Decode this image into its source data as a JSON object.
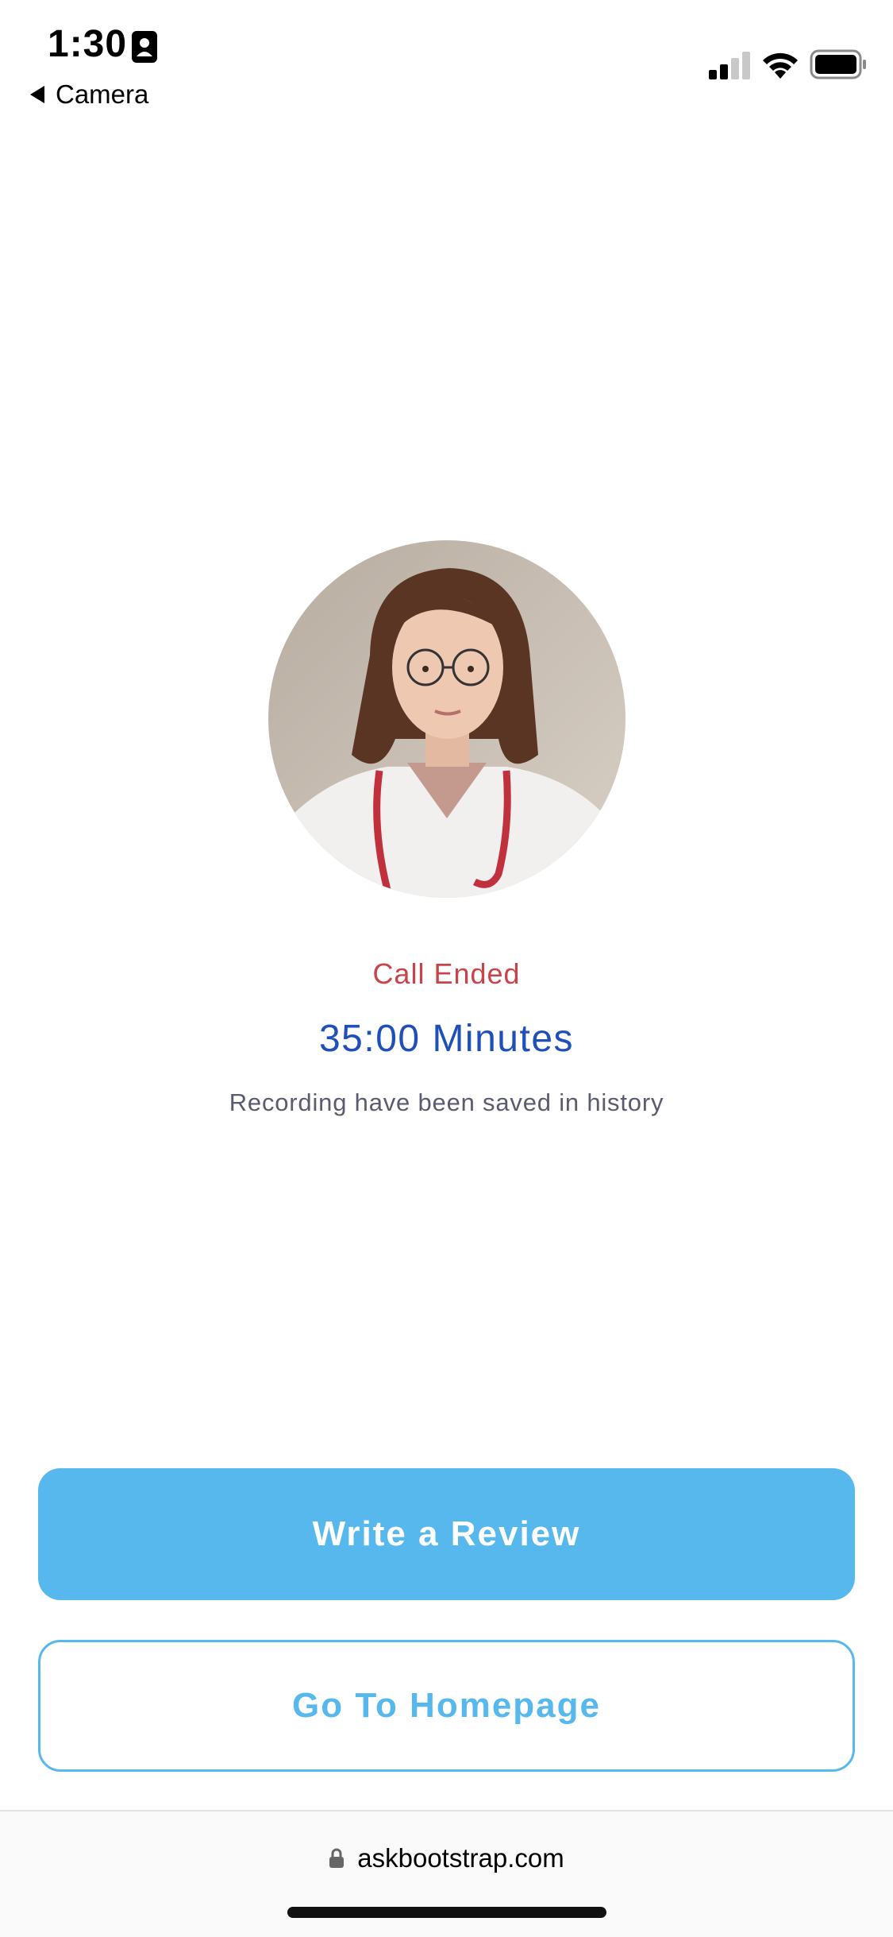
{
  "status_bar": {
    "time": "1:30",
    "back_label": "Camera",
    "icons": [
      "contact-card-icon",
      "cellular-signal-icon",
      "wifi-icon",
      "battery-icon"
    ]
  },
  "call": {
    "status": "Call Ended",
    "duration": "35:00 Minutes",
    "note": "Recording have been saved in history",
    "avatar": "doctor-photo"
  },
  "actions": {
    "primary_label": "Write a Review",
    "secondary_label": "Go To Homepage"
  },
  "browser": {
    "url": "askbootstrap.com"
  },
  "colors": {
    "accent": "#56b8ec",
    "status_red": "#c9434a",
    "duration_blue": "#1f4fb8",
    "note_gray": "#5b5b70"
  }
}
